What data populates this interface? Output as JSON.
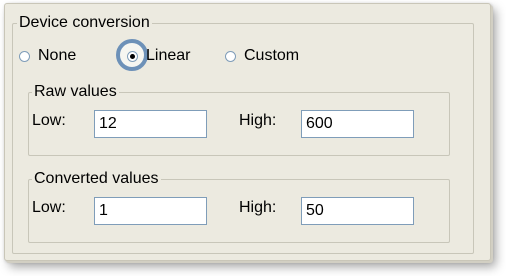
{
  "device_conversion": {
    "title": "Device conversion",
    "options": [
      {
        "label": "None",
        "checked": false
      },
      {
        "label": "Linear",
        "checked": true
      },
      {
        "label": "Custom",
        "checked": false
      }
    ]
  },
  "raw_values": {
    "title": "Raw values",
    "low_label": "Low:",
    "low_value": "12",
    "high_label": "High:",
    "high_value": "600"
  },
  "converted_values": {
    "title": "Converted values",
    "low_label": "Low:",
    "low_value": "1",
    "high_label": "High:",
    "high_value": "50"
  },
  "colors": {
    "panel_bg": "#eceae0",
    "highlight": "#6d91b8",
    "input_border": "#7f9db9"
  }
}
